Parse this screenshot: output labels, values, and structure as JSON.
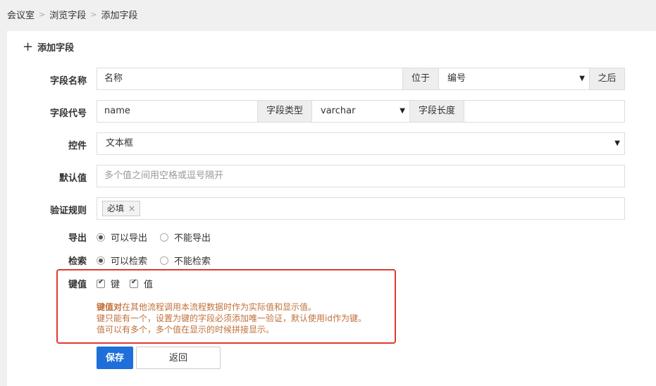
{
  "breadcrumb": {
    "items": [
      "会议室",
      "浏览字段",
      "添加字段"
    ]
  },
  "panel": {
    "title": "添加字段"
  },
  "form": {
    "name": {
      "label": "字段名称",
      "value": "名称",
      "position_label": "位于",
      "position_select": "编号",
      "after_label": "之后"
    },
    "code": {
      "label": "字段代号",
      "value": "name",
      "type_label": "字段类型",
      "type_select": "varchar",
      "length_label": "字段长度",
      "length_value": ""
    },
    "control": {
      "label": "控件",
      "value": "文本框"
    },
    "default": {
      "label": "默认值",
      "placeholder": "多个值之间用空格或逗号隔开"
    },
    "rules": {
      "label": "验证规则",
      "tag": "必填",
      "tag_remove": "×"
    },
    "export": {
      "label": "导出",
      "options": [
        "可以导出",
        "不能导出"
      ],
      "selected": 0
    },
    "search": {
      "label": "检索",
      "options": [
        "可以检索",
        "不能检索"
      ],
      "selected": 0
    },
    "keyvalue": {
      "label": "键值",
      "key_label": "键",
      "value_label": "值",
      "key_checked": true,
      "value_checked": true,
      "hint_strong": "键值对",
      "hint_line1": "在其他流程调用本流程数据时作为实际值和显示值。",
      "hint_line2": "键只能有一个，设置为键的字段必须添加唯一验证，默认使用id作为键。",
      "hint_line3": "值可以有多个，多个值在显示的时候拼接显示。"
    }
  },
  "actions": {
    "save": "保存",
    "back": "返回"
  },
  "colors": {
    "primary": "#1e6fd9",
    "highlight_border": "#e03a32",
    "hint_text": "#c0713a"
  }
}
